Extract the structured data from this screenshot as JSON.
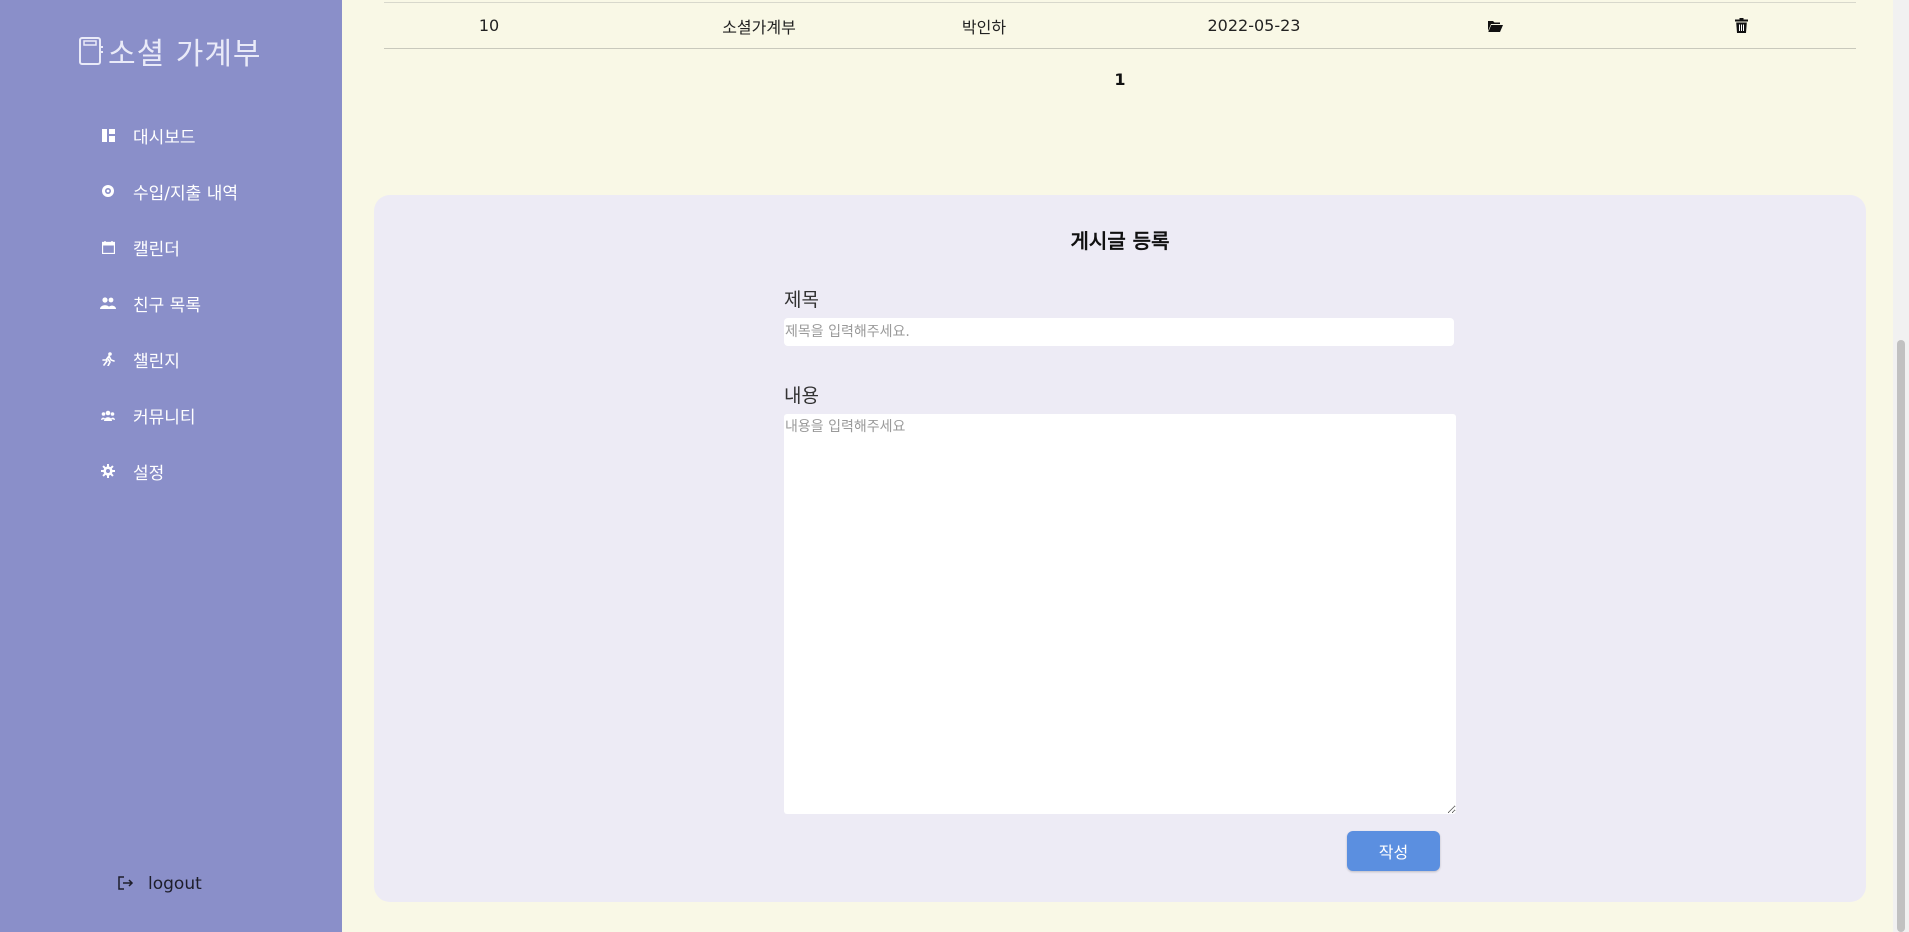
{
  "brand": {
    "title": "소셜 가계부"
  },
  "sidebar": {
    "items": [
      {
        "label": "대시보드",
        "icon": "dashboard-icon"
      },
      {
        "label": "수입/지출 내역",
        "icon": "piggy-bank-icon"
      },
      {
        "label": "캘린더",
        "icon": "calendar-icon"
      },
      {
        "label": "친구 목록",
        "icon": "users-icon"
      },
      {
        "label": "챌린지",
        "icon": "running-icon"
      },
      {
        "label": "커뮤니티",
        "icon": "community-icon"
      },
      {
        "label": "설정",
        "icon": "gear-icon"
      }
    ],
    "logout_label": "logout"
  },
  "posts": {
    "rows": [
      {
        "no": "10",
        "title": "소셜가계부",
        "author": "박인하",
        "date": "2022-05-23"
      }
    ]
  },
  "pagination": {
    "current": "1"
  },
  "form": {
    "heading": "게시글 등록",
    "title_label": "제목",
    "title_placeholder": "제목을 입력해주세요.",
    "content_label": "내용",
    "content_placeholder": "내용을 입력해주세요",
    "submit_label": "작성"
  },
  "colors": {
    "sidebar_bg": "#8a8fc9",
    "page_bg": "#f9f8e6",
    "panel_bg": "#edebf5",
    "button_bg": "#5b8fe0"
  }
}
